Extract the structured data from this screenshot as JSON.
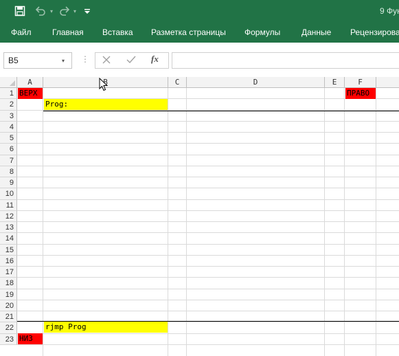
{
  "titlebar": {
    "window_title": "9 Фун",
    "qat": {
      "save_icon": "save-icon",
      "undo_icon": "undo-icon",
      "redo_icon": "redo-icon",
      "customize_icon": "chevron-down-icon"
    }
  },
  "ribbon": {
    "tabs": [
      "Файл",
      "Главная",
      "Вставка",
      "Разметка страницы",
      "Формулы",
      "Данные",
      "Рецензирова"
    ]
  },
  "formula_bar": {
    "name_box": "B5",
    "cancel_icon": "close-icon",
    "enter_icon": "check-icon",
    "fx_label": "fx",
    "value": ""
  },
  "grid": {
    "columns": [
      "A",
      "B",
      "C",
      "D",
      "E",
      "F"
    ],
    "rows": [
      "1",
      "2",
      "3",
      "4",
      "5",
      "6",
      "7",
      "8",
      "9",
      "10",
      "11",
      "12",
      "13",
      "14",
      "15",
      "16",
      "17",
      "18",
      "19",
      "20",
      "21",
      "22",
      "23"
    ],
    "cells": {
      "A1": "ВЕРХ",
      "F1": "ПРАВО",
      "B2": "Prog:",
      "B21": "rjmp Prog",
      "A22": "НИЗ"
    },
    "colors": {
      "red": "#ff0000",
      "yellow": "#ffff00",
      "accent": "#217346"
    }
  }
}
